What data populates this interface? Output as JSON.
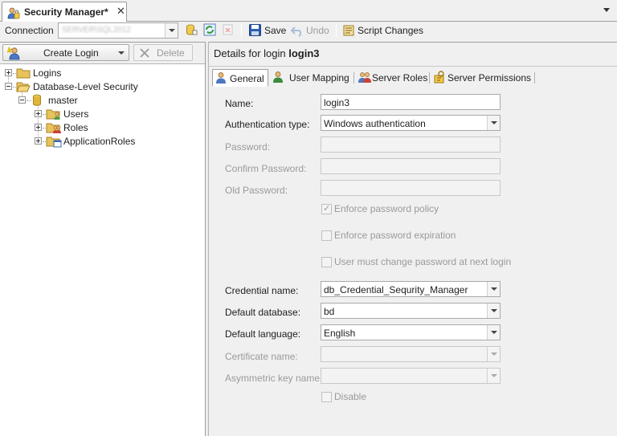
{
  "document_tab": {
    "title": "Security Manager*",
    "close_glyph": "✕",
    "icon": "security-manager-icon"
  },
  "toolbar": {
    "connection_label": "Connection",
    "connection_value": "SERVER\\SQL2012",
    "save_label": "Save",
    "undo_label": "Undo",
    "script_changes_label": "Script Changes"
  },
  "left_toolbar": {
    "create_login_label": "Create Login",
    "delete_label": "Delete"
  },
  "tree": {
    "nodes": [
      {
        "label": "Logins",
        "icon": "folder-icon",
        "expanded": false
      },
      {
        "label": "Database-Level Security",
        "icon": "folder-open-icon",
        "expanded": true
      },
      {
        "label": "master",
        "icon": "database-icon",
        "expanded": true
      },
      {
        "label": "Users",
        "icon": "users-folder-icon",
        "expanded": false
      },
      {
        "label": "Roles",
        "icon": "roles-folder-icon",
        "expanded": false
      },
      {
        "label": "ApplicationRoles",
        "icon": "approles-folder-icon",
        "expanded": false
      }
    ]
  },
  "details": {
    "header_prefix": "Details for login ",
    "login_name": "login3"
  },
  "tabs": [
    {
      "label": "General",
      "icon": "user-icon",
      "active": true
    },
    {
      "label": "User Mapping",
      "icon": "user-icon",
      "active": false
    },
    {
      "label": "Server Roles",
      "icon": "users-icon",
      "active": false
    },
    {
      "label": "Server Permissions",
      "icon": "key-icon",
      "active": false
    }
  ],
  "form": {
    "name": {
      "label": "Name:",
      "value": "login3"
    },
    "auth_type": {
      "label": "Authentication type:",
      "value": "Windows authentication"
    },
    "password": {
      "label": "Password:",
      "value": ""
    },
    "confirm_password": {
      "label": "Confirm Password:",
      "value": ""
    },
    "old_password": {
      "label": "Old Password:",
      "value": ""
    },
    "enforce_policy": {
      "label": "Enforce password policy",
      "checked": true
    },
    "enforce_expiration": {
      "label": "Enforce password expiration",
      "checked": false
    },
    "must_change": {
      "label": "User must change password at next login",
      "checked": false
    },
    "credential_name": {
      "label": "Credential name:",
      "value": "db_Credential_Sequrity_Manager"
    },
    "default_database": {
      "label": "Default database:",
      "value": "bd"
    },
    "default_language": {
      "label": "Default language:",
      "value": "English"
    },
    "certificate_name": {
      "label": "Certificate name:",
      "value": ""
    },
    "asymmetric_key_name": {
      "label": "Asymmetric key name:",
      "value": ""
    },
    "disable": {
      "label": "Disable",
      "checked": false
    }
  },
  "colors": {
    "folder": "#e8c25a",
    "database": "#e2b53a",
    "save_blue": "#2a5db0",
    "refresh_green": "#2f9a3a"
  }
}
